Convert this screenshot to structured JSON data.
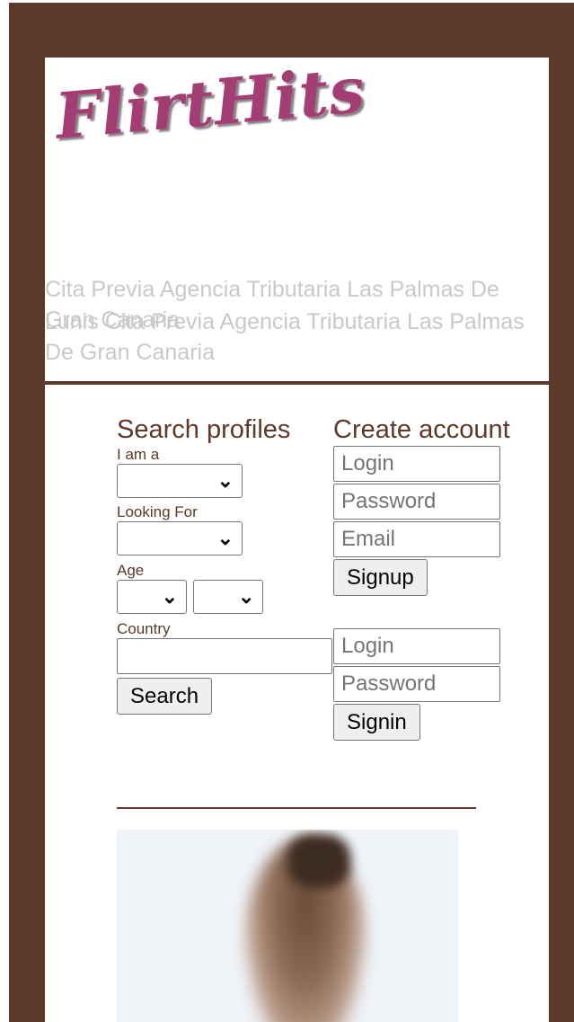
{
  "brand": {
    "logo_text": "FlirtHits"
  },
  "header": {
    "title_line_a": "Cita Previa Agencia Tributaria Las Palmas De Gran Canaria",
    "title_line_b": "Lunis Cita Previa Agencia Tributaria Las Palmas De Gran Canaria"
  },
  "search": {
    "heading": "Search profiles",
    "iam_label": "I am a",
    "iam_value": "",
    "looking_label": "Looking For",
    "looking_value": "",
    "age_label": "Age",
    "age_from_value": "",
    "age_to_value": "",
    "country_label": "Country",
    "country_value": "",
    "search_button": "Search"
  },
  "signup": {
    "heading": "Create account",
    "login_placeholder": "Login",
    "password_placeholder": "Password",
    "email_placeholder": "Email",
    "signup_button": "Signup"
  },
  "signin": {
    "login_placeholder": "Login",
    "password_placeholder": "Password",
    "signin_button": "Signin"
  },
  "colors": {
    "frame": "#5b3a29",
    "logo": "#a43d73",
    "muted_title": "#c9c9c9"
  },
  "icons": {
    "select_arrow": "chevron-down-icon"
  }
}
